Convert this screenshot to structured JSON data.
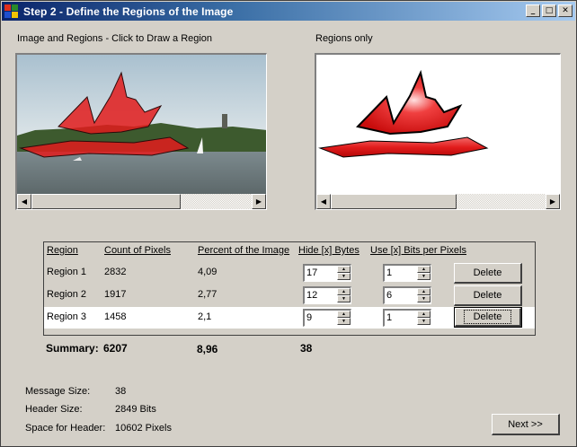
{
  "window": {
    "title": "Step 2 - Define the Regions of the Image",
    "min_glyph": "_",
    "max_glyph": "□",
    "close_glyph": "✕"
  },
  "panes": {
    "left_label": "Image and Regions - Click to Draw a Region",
    "right_label": "Regions only"
  },
  "scroll": {
    "left_arrow": "◀",
    "right_arrow": "▶"
  },
  "table": {
    "headers": {
      "region": "Region",
      "count": "Count of Pixels",
      "percent": "Percent of the Image",
      "hide": "Hide [x] Bytes",
      "bits": "Use [x] Bits per Pixels"
    },
    "rows": [
      {
        "name": "Region 1",
        "count": "2832",
        "percent": "4,09",
        "hide": "17",
        "bits": "1",
        "delete": "Delete"
      },
      {
        "name": "Region 2",
        "count": "1917",
        "percent": "2,77",
        "hide": "12",
        "bits": "6",
        "delete": "Delete"
      },
      {
        "name": "Region 3",
        "count": "1458",
        "percent": "2,1",
        "hide": "9",
        "bits": "1",
        "delete": "Delete"
      }
    ],
    "spin_up": "▲",
    "spin_down": "▼"
  },
  "summary": {
    "label": "Summary:",
    "count": "6207",
    "percent": "8,96",
    "hide": "38"
  },
  "info": {
    "message_size_label": "Message Size:",
    "message_size_value": "38",
    "header_size_label": "Header Size:",
    "header_size_value": "2849 Bits",
    "space_label": "Space for Header:",
    "space_value": "10602 Pixels"
  },
  "next_button": "Next >>",
  "colors": {
    "region_fill": "#e21c1c",
    "title_bar_start": "#0a246a",
    "window_bg": "#d4d0c8"
  }
}
